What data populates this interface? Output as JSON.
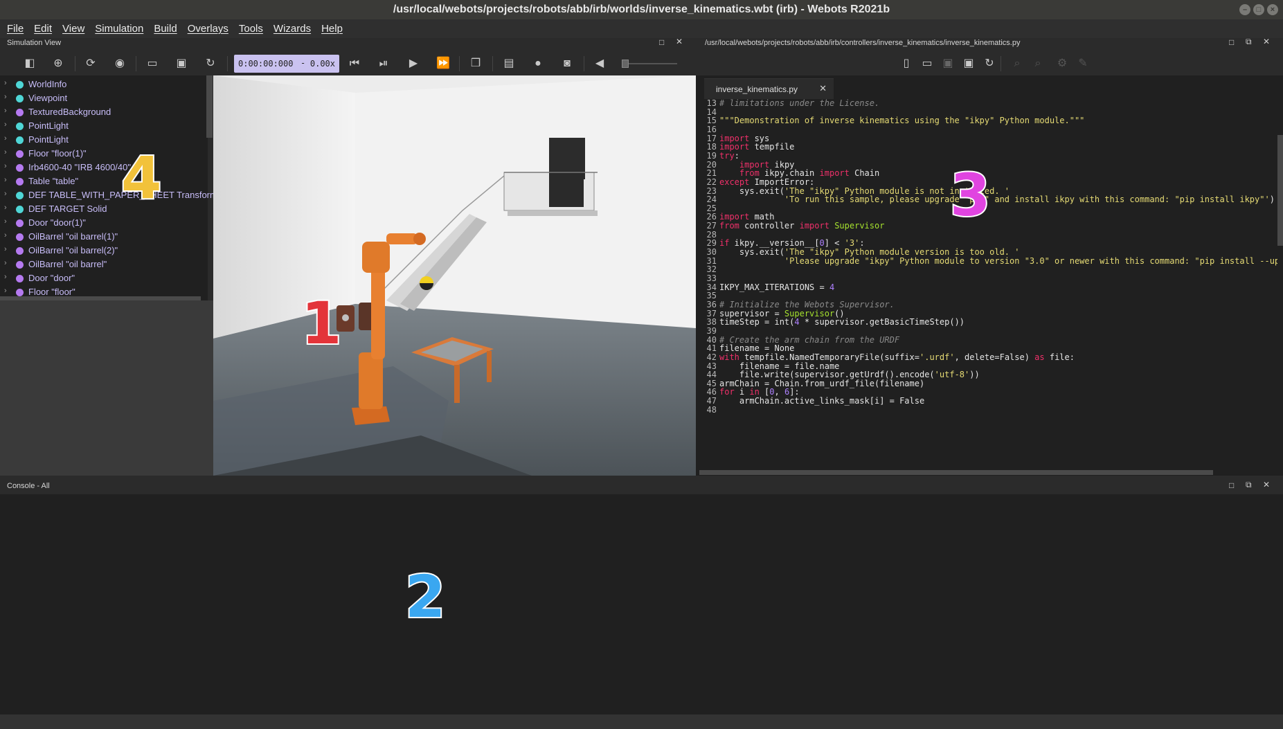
{
  "window": {
    "title": "/usr/local/webots/projects/robots/abb/irb/worlds/inverse_kinematics.wbt (irb) - Webots R2021b"
  },
  "menu": [
    "File",
    "Edit",
    "View",
    "Simulation",
    "Build",
    "Overlays",
    "Tools",
    "Wizards",
    "Help"
  ],
  "simulation_view": {
    "header": "Simulation View",
    "time": "0:00:00:000",
    "dash": "-",
    "speed": "0.00x"
  },
  "scene_tree": [
    {
      "label": "WorldInfo",
      "color": "#4fd6d6"
    },
    {
      "label": "Viewpoint",
      "color": "#4fd6d6"
    },
    {
      "label": "TexturedBackground",
      "color": "#b57af0"
    },
    {
      "label": "PointLight",
      "color": "#4fd6d6"
    },
    {
      "label": "PointLight",
      "color": "#4fd6d6"
    },
    {
      "label": "Floor \"floor(1)\"",
      "color": "#b57af0"
    },
    {
      "label": "Irb4600-40 \"IRB 4600/40\"",
      "color": "#b57af0"
    },
    {
      "label": "Table \"table\"",
      "color": "#b57af0"
    },
    {
      "label": "DEF TABLE_WITH_PAPER_SHEET Transform",
      "color": "#4fd6d6"
    },
    {
      "label": "DEF TARGET Solid",
      "color": "#4fd6d6"
    },
    {
      "label": "Door \"door(1)\"",
      "color": "#b57af0"
    },
    {
      "label": "OilBarrel \"oil barrel(1)\"",
      "color": "#b57af0"
    },
    {
      "label": "OilBarrel \"oil barrel(2)\"",
      "color": "#b57af0"
    },
    {
      "label": "OilBarrel \"oil barrel\"",
      "color": "#b57af0"
    },
    {
      "label": "Door \"door\"",
      "color": "#b57af0"
    },
    {
      "label": "Floor \"floor\"",
      "color": "#b57af0"
    }
  ],
  "editor": {
    "path": "/usr/local/webots/projects/robots/abb/irb/controllers/inverse_kinematics/inverse_kinematics.py",
    "tab": "inverse_kinematics.py",
    "lines": [
      {
        "n": "13",
        "html": "<span class=\"cm\"># limitations under the License.</span>"
      },
      {
        "n": "14",
        "html": ""
      },
      {
        "n": "15",
        "html": "<span class=\"st\">\"\"\"Demonstration of inverse kinematics using the \"ikpy\" Python module.\"\"\"</span>"
      },
      {
        "n": "16",
        "html": ""
      },
      {
        "n": "17",
        "html": "<span class=\"kw\">import</span> sys"
      },
      {
        "n": "18",
        "html": "<span class=\"kw\">import</span> tempfile"
      },
      {
        "n": "19",
        "html": "<span class=\"kw\">try</span>:"
      },
      {
        "n": "20",
        "html": "    <span class=\"kw\">import</span> ikpy"
      },
      {
        "n": "21",
        "html": "    <span class=\"kw\">from</span> ikpy.chain <span class=\"kw\">import</span> Chain"
      },
      {
        "n": "22",
        "html": "<span class=\"kw\">except</span> ImportError:"
      },
      {
        "n": "23",
        "html": "    sys.exit(<span class=\"st\">'The \"ikpy\" Python module is not installed. '</span>"
      },
      {
        "n": "24",
        "html": "             <span class=\"st\">'To run this sample, please upgrade \"pip\" and install ikpy with this command: \"pip install ikpy\"'</span>)"
      },
      {
        "n": "25",
        "html": ""
      },
      {
        "n": "26",
        "html": "<span class=\"kw\">import</span> math"
      },
      {
        "n": "27",
        "html": "<span class=\"kw\">from</span> controller <span class=\"kw\">import</span> <span class=\"fn\">Supervisor</span>"
      },
      {
        "n": "28",
        "html": ""
      },
      {
        "n": "29",
        "html": "<span class=\"kw\">if</span> ikpy.__version__[<span class=\"nm\">0</span>] &lt; <span class=\"st\">'3'</span>:"
      },
      {
        "n": "30",
        "html": "    sys.exit(<span class=\"st\">'The \"ikpy\" Python module version is too old. '</span>"
      },
      {
        "n": "31",
        "html": "             <span class=\"st\">'Please upgrade \"ikpy\" Python module to version \"3.0\" or newer with this command: \"pip install --upgrade ikpy\"'</span>)"
      },
      {
        "n": "32",
        "html": ""
      },
      {
        "n": "33",
        "html": ""
      },
      {
        "n": "34",
        "html": "IKPY_MAX_ITERATIONS = <span class=\"nm\">4</span>"
      },
      {
        "n": "35",
        "html": ""
      },
      {
        "n": "36",
        "html": "<span class=\"cm\"># Initialize the Webots Supervisor.</span>"
      },
      {
        "n": "37",
        "html": "supervisor = <span class=\"fn\">Supervisor</span>()"
      },
      {
        "n": "38",
        "html": "timeStep = int(<span class=\"nm\">4</span> * supervisor.getBasicTimeStep())"
      },
      {
        "n": "39",
        "html": ""
      },
      {
        "n": "40",
        "html": "<span class=\"cm\"># Create the arm chain from the URDF</span>"
      },
      {
        "n": "41",
        "html": "filename = None"
      },
      {
        "n": "42",
        "html": "<span class=\"kw\">with</span> tempfile.NamedTemporaryFile(suffix=<span class=\"st\">'.urdf'</span>, delete=False) <span class=\"kw\">as</span> file:"
      },
      {
        "n": "43",
        "html": "    filename = file.name"
      },
      {
        "n": "44",
        "html": "    file.write(supervisor.getUrdf().encode(<span class=\"st\">'utf-8'</span>))"
      },
      {
        "n": "45",
        "html": "armChain = Chain.from_urdf_file(filename)"
      },
      {
        "n": "46",
        "html": "<span class=\"kw\">for</span> i <span class=\"kw\">in</span> [<span class=\"nm\">0</span>, <span class=\"nm\">6</span>]:"
      },
      {
        "n": "47",
        "html": "    armChain.active_links_mask[i] = False"
      },
      {
        "n": "48",
        "html": ""
      }
    ]
  },
  "console": {
    "header": "Console - All"
  },
  "annotations": [
    {
      "label": "1",
      "color": "#e3343a"
    },
    {
      "label": "2",
      "color": "#3aa7f0"
    },
    {
      "label": "3",
      "color": "#e044e0"
    },
    {
      "label": "4",
      "color": "#f2c23a"
    }
  ]
}
